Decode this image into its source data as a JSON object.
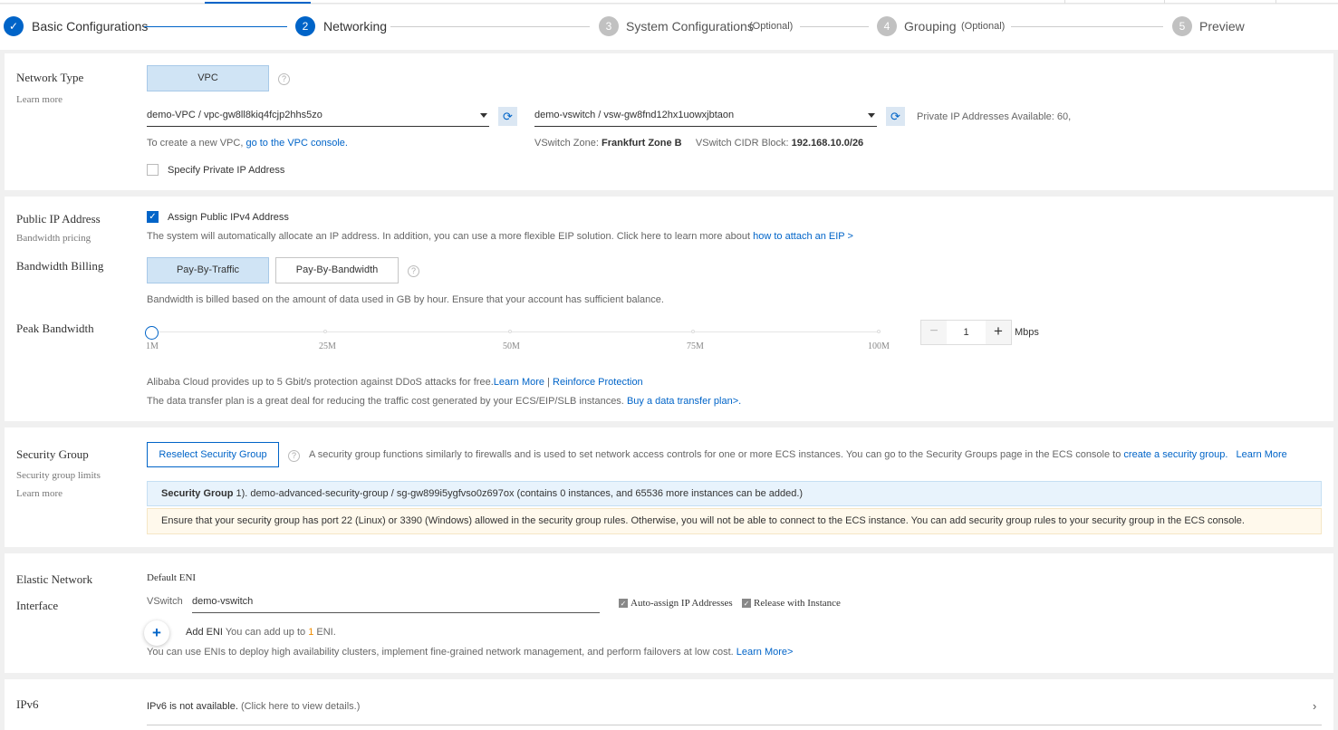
{
  "steps": [
    {
      "num": "1",
      "label": "Basic Configurations",
      "optional": "",
      "state": "done"
    },
    {
      "num": "2",
      "label": "Networking",
      "optional": "",
      "state": "active"
    },
    {
      "num": "3",
      "label": "System Configurations",
      "optional": "(Optional)",
      "state": "todo"
    },
    {
      "num": "4",
      "label": "Grouping",
      "optional": "(Optional)",
      "state": "todo"
    },
    {
      "num": "5",
      "label": "Preview",
      "optional": "",
      "state": "todo"
    }
  ],
  "network": {
    "title": "Network Type",
    "learn_more": "Learn more",
    "vpc_button": "VPC",
    "vpc_select": "demo-VPC / vpc-gw8ll8kiq4fcjp2hhs5zo",
    "vpc_hint": "To create a new VPC,",
    "vpc_hint_link": "go to the VPC console.",
    "vswitch_select": "demo-vswitch / vsw-gw8fnd12hx1uowxjbtaon",
    "private_ip_available": "Private IP Addresses Available: 60,",
    "zone_label": "VSwitch Zone:",
    "zone_value": "Frankfurt Zone B",
    "cidr_label": "VSwitch CIDR Block:",
    "cidr_value": "192.168.10.0/26",
    "specify_ip": "Specify Private IP Address"
  },
  "public_ip": {
    "title": "Public IP Address",
    "sub": "Bandwidth pricing",
    "assign_label": "Assign Public IPv4 Address",
    "assign_note": "The system will automatically allocate an IP address. In addition, you can use a more flexible EIP solution. Click here to learn more about",
    "assign_link": "how to attach an EIP >",
    "billing_title": "Bandwidth Billing",
    "billing_options": [
      "Pay-By-Traffic",
      "Pay-By-Bandwidth"
    ],
    "billing_note": "Bandwidth is billed based on the amount of data used in GB by hour. Ensure that your account has sufficient balance.",
    "peak_title": "Peak Bandwidth",
    "slider_ticks": [
      "1M",
      "25M",
      "50M",
      "75M",
      "100M"
    ],
    "bandwidth_value": "1",
    "bandwidth_unit": "Mbps",
    "minus": "−",
    "plus": "+",
    "ddos_note": "Alibaba Cloud provides up to 5 Gbit/s protection against DDoS attacks for free.",
    "ddos_link1": "Learn More",
    "ddos_sep": "|",
    "ddos_link2": "Reinforce Protection",
    "transfer_note": "The data transfer plan is a great deal for reducing the traffic cost generated by your ECS/EIP/SLB instances.",
    "transfer_link": "Buy a data transfer plan>."
  },
  "security": {
    "title": "Security Group",
    "sub1": "Security group limits",
    "sub2": "Learn more",
    "reselect_button": "Reselect Security Group",
    "desc": "A security group functions similarly to firewalls and is used to set network access controls for one or more ECS instances. You can go to the Security Groups page in the ECS console to",
    "desc_link": "create a security group.",
    "learn_more": "Learn More",
    "sg_label": "Security Group",
    "sg_value": "1). demo-advanced-security-group / sg-gw899i5ygfvso0z697ox (contains 0 instances, and 65536 more instances can be added.)",
    "warning": "Ensure that your security group has port 22 (Linux) or 3390 (Windows) allowed in the security group rules. Otherwise, you will not be able to connect to the ECS instance. You can add security group rules to your security group in the ECS console."
  },
  "eni": {
    "title_line1": "Elastic Network",
    "title_line2": "Interface",
    "default_eni": "Default ENI",
    "vswitch_label": "VSwitch",
    "vswitch_value": "demo-vswitch",
    "auto_assign": "Auto-assign IP Addresses",
    "release": "Release with Instance",
    "add_eni": "Add ENI",
    "add_eni_note_pre": "You can add up to",
    "add_eni_count": "1",
    "add_eni_note_post": "ENI.",
    "footer_note": "You can use ENIs to deploy high availability clusters, implement fine-grained network management, and perform failovers at low cost.",
    "footer_link": "Learn More>"
  },
  "ipv6": {
    "title": "IPv6",
    "status": "IPv6 is not available.",
    "details": "(Click here to view details.)"
  },
  "colors": {
    "accent": "#0064c8",
    "selected_bg": "#d0e4f5",
    "info_bg": "#e8f3fc",
    "warn_bg": "#fff9ec",
    "orange": "#f08c00"
  }
}
